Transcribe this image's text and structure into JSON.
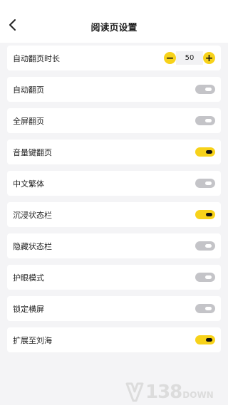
{
  "header": {
    "title": "阅读页设置",
    "back_icon": "chevron-left-icon"
  },
  "settings": [
    {
      "label": "自动翻页时长",
      "type": "stepper",
      "value": "50",
      "minus_label": "−",
      "plus_label": "+"
    },
    {
      "label": "自动翻页",
      "type": "toggle",
      "on": false
    },
    {
      "label": "全屏翻页",
      "type": "toggle",
      "on": false
    },
    {
      "label": "音量键翻页",
      "type": "toggle",
      "on": true
    },
    {
      "label": "中文繁体",
      "type": "toggle",
      "on": false
    },
    {
      "label": "沉浸状态栏",
      "type": "toggle",
      "on": true
    },
    {
      "label": "隐藏状态栏",
      "type": "toggle",
      "on": false
    },
    {
      "label": "护眼模式",
      "type": "toggle",
      "on": false
    },
    {
      "label": "锁定横屏",
      "type": "toggle",
      "on": false
    },
    {
      "label": "扩展至刘海",
      "type": "toggle",
      "on": true
    }
  ],
  "colors": {
    "accent": "#f7d21a",
    "toggle_off": "#c4c4c8",
    "background": "#f4f4f6"
  },
  "watermark": {
    "number": "138",
    "suffix": "DOWN"
  }
}
